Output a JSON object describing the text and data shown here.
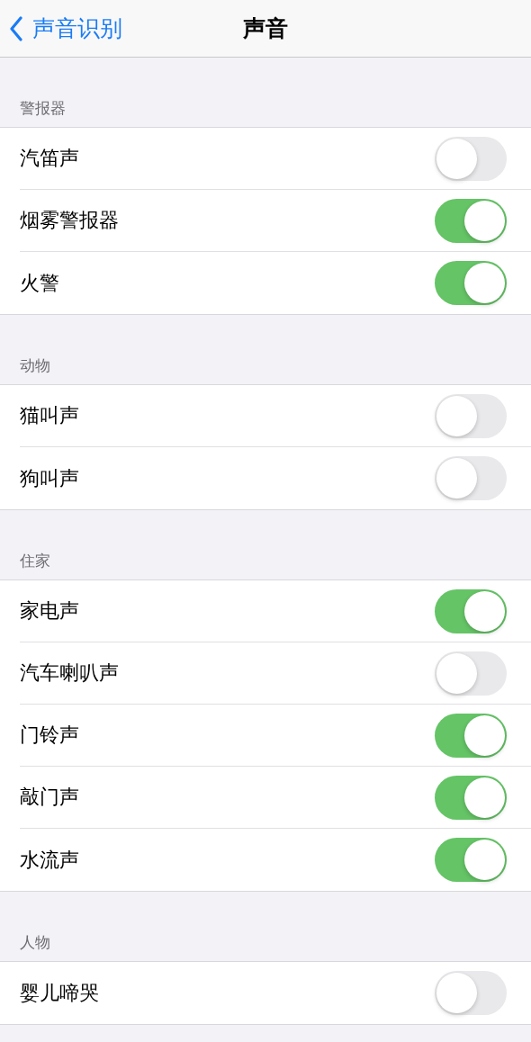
{
  "nav_bar": {
    "back_label": "声音识别",
    "title": "声音"
  },
  "sections": [
    {
      "header": "警报器",
      "items": [
        {
          "label": "汽笛声",
          "on": false
        },
        {
          "label": "烟雾警报器",
          "on": true
        },
        {
          "label": "火警",
          "on": true
        }
      ]
    },
    {
      "header": "动物",
      "items": [
        {
          "label": "猫叫声",
          "on": false
        },
        {
          "label": "狗叫声",
          "on": false
        }
      ]
    },
    {
      "header": "住家",
      "items": [
        {
          "label": "家电声",
          "on": true
        },
        {
          "label": "汽车喇叭声",
          "on": false
        },
        {
          "label": "门铃声",
          "on": true
        },
        {
          "label": "敲门声",
          "on": true
        },
        {
          "label": "水流声",
          "on": true
        }
      ]
    },
    {
      "header": "人物",
      "items": [
        {
          "label": "婴儿啼哭",
          "on": false
        }
      ]
    }
  ]
}
